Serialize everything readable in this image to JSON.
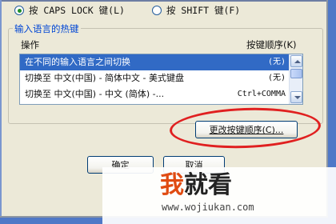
{
  "radio_options": [
    {
      "label": "按 CAPS LOCK 键(L)",
      "selected": true
    },
    {
      "label": "按 SHIFT 键(F)",
      "selected": false
    }
  ],
  "group": {
    "title": "输入语言的热键",
    "headers": {
      "action": "操作",
      "sequence": "按键顺序(K)"
    },
    "rows": [
      {
        "action": "在不同的输入语言之间切换",
        "sequence": "(无)",
        "selected": true
      },
      {
        "action": "切换至 中文(中国) - 简体中文 - 美式键盘",
        "sequence": "(无)",
        "selected": false
      },
      {
        "action": "切换至 中文(中国) - 中文 (简体) -...",
        "sequence": "Ctrl+COMMA",
        "selected": false
      }
    ]
  },
  "buttons": {
    "change_sequence": "更改按键顺序(C)...",
    "ok": "确定",
    "cancel": "取消"
  },
  "watermark": {
    "brand_prefix": "我",
    "brand_suffix": "就看",
    "url": "www.wojiukan.com"
  }
}
